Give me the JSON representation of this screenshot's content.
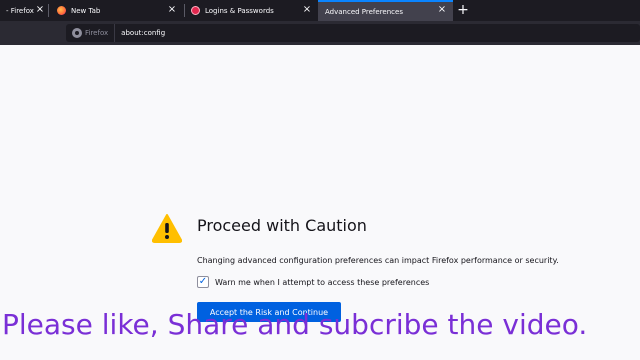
{
  "tabs": [
    {
      "label": "- Firefox",
      "favicon": "firefox",
      "active": false
    },
    {
      "label": "New Tab",
      "favicon": "firefox",
      "active": false
    },
    {
      "label": "Logins & Passwords",
      "favicon": "lockwise",
      "active": false
    },
    {
      "label": "Advanced Preferences",
      "favicon": "",
      "active": true
    }
  ],
  "toolbar": {
    "identity_label": "Firefox",
    "url": "about:config"
  },
  "page": {
    "title": "Proceed with Caution",
    "description": "Changing advanced configuration preferences can impact Firefox performance or security.",
    "checkbox_label": "Warn me when I attempt to access these preferences",
    "checkbox_checked": true,
    "accept_button": "Accept the Risk and Continue"
  },
  "overlay_caption": "Please like, Share and subcribe the video.",
  "colors": {
    "accent": "#0061e0",
    "warning": "#ffbf00",
    "caption": "#7a2fd6"
  }
}
